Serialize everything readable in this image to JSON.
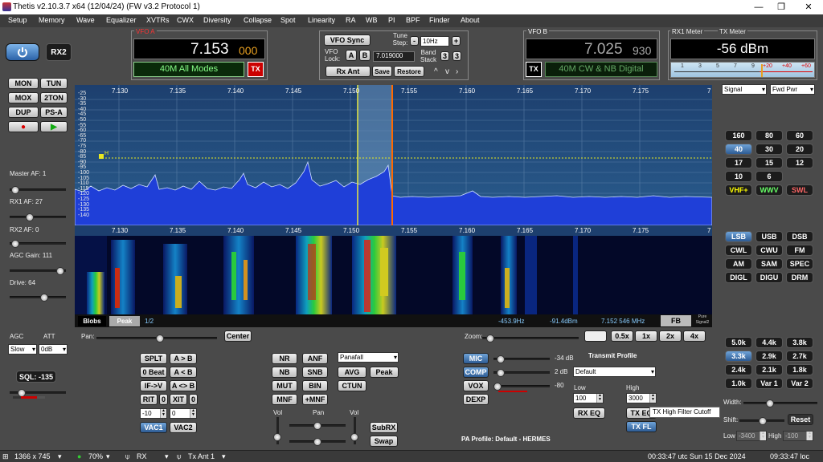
{
  "window": {
    "title": "Thetis v2.10.3.7 x64 (12/04/24) (FW v3.2 Protocol 1)",
    "min": "—",
    "max": "❐",
    "close": "✕"
  },
  "menu": [
    "Setup",
    "Memory",
    "Wave",
    "Equalizer",
    "XVTRs",
    "CWX",
    "Diversity",
    "Collapse",
    "Spot",
    "Linearity",
    "RA",
    "WB",
    "PI",
    "BPF",
    "Finder",
    "About"
  ],
  "power": {
    "rx2": "RX2"
  },
  "mode_buttons": {
    "mon": "MON",
    "tun": "TUN",
    "mox": "MOX",
    "tton": "2TON",
    "dup": "DUP",
    "psa": "PS-A"
  },
  "vfoa": {
    "label": "VFO A",
    "freq": "7.153",
    "freq_sub": "000",
    "mode": "40M All Modes",
    "tx": "TX"
  },
  "vfo_center": {
    "sync": "VFO Sync",
    "tune_step_label": "Tune Step:",
    "tune_step": "10Hz",
    "vfo_lock_label": "VFO Lock:",
    "a": "A",
    "b": "B",
    "lock_freq": "7.019000",
    "band_stack_label": "Band Stack",
    "bs1": "3",
    "bs2": "3",
    "rx_ant": "Rx Ant",
    "save": "Save",
    "restore": "Restore",
    "minus": "-",
    "plus": "+",
    "up": "^",
    "down": "v"
  },
  "vfob": {
    "label": "VFO B",
    "freq": "7.025",
    "freq_sub": "930",
    "mode": "40M CW & NB Digital",
    "tx": "TX"
  },
  "meters": {
    "rx1_label": "RX1 Meter",
    "tx_label": "TX Meter",
    "reading": "-56 dBm",
    "scale": [
      "1",
      "3",
      "5",
      "7",
      "9",
      "+20",
      "+40",
      "+60"
    ],
    "signal": "Signal",
    "fwd": "Fwd Pwr"
  },
  "panadapter": {
    "freqs": [
      "7.130",
      "7.135",
      "7.140",
      "7.145",
      "7.150",
      "7.155",
      "7.160",
      "7.165",
      "7.170",
      "7.175"
    ],
    "dbs": [
      "-25",
      "-30",
      "-35",
      "-40",
      "-45",
      "-50",
      "-55",
      "-60",
      "-65",
      "-70",
      "-75",
      "-80",
      "-85",
      "-90",
      "-95",
      "-100",
      "-105",
      "-110",
      "-115",
      "-120",
      "-125",
      "-130",
      "-135",
      "-140"
    ],
    "h_marker": "H",
    "edge": "7",
    "blobs": "Blobs",
    "peak": "Peak",
    "page": "1/2",
    "cursor_offset": "-453.9Hz",
    "cursor_db": "-91.4dBm",
    "cursor_freq": "7.152 546 MHz",
    "fb": "FB",
    "pure": "Pure Signal2"
  },
  "left": {
    "master_af": "Master AF:  1",
    "rx1_af": "RX1 AF:  27",
    "rx2_af": "RX2 AF:  0",
    "agc_gain": "AGC Gain:  111",
    "drive": "Drive:  64",
    "agc": "AGC",
    "att": "ATT",
    "agc_val": "Slow",
    "att_val": "0dB",
    "sql": "SQL: -135"
  },
  "bands": [
    "160",
    "80",
    "60",
    "40",
    "30",
    "20",
    "17",
    "15",
    "12",
    "10",
    "6",
    "VHF+",
    "WWV",
    "SWL"
  ],
  "modes": [
    "LSB",
    "USB",
    "DSB",
    "CWL",
    "CWU",
    "FM",
    "AM",
    "SAM",
    "SPEC",
    "DIGL",
    "DIGU",
    "DRM"
  ],
  "filters": [
    "5.0k",
    "4.4k",
    "3.8k",
    "3.3k",
    "2.9k",
    "2.7k",
    "2.4k",
    "2.1k",
    "1.8k",
    "1.0k",
    "Var 1",
    "Var 2"
  ],
  "filter_controls": {
    "width": "Width:",
    "shift": "Shift:",
    "reset": "Reset",
    "low": "Low",
    "low_val": "-3400",
    "high": "High",
    "high_val": "-100"
  },
  "pan_zoom": {
    "pan": "Pan:",
    "center": "Center",
    "zoom": "Zoom:",
    "z": [
      "0.5x",
      "1x",
      "2x",
      "4x"
    ]
  },
  "dsp": {
    "splt": "SPLT",
    "a2b": "A > B",
    "zbeat": "0 Beat",
    "b2a": "A < B",
    "ifv": "IF->V",
    "aswap": "A <> B",
    "rit": "RIT",
    "rit0": "0",
    "xit": "XIT",
    "xit0": "0",
    "rit_val": "-10",
    "xit_val": "0",
    "vac1": "VAC1",
    "vac2": "VAC2",
    "nr": "NR",
    "anf": "ANF",
    "nb": "NB",
    "snb": "SNB",
    "mut": "MUT",
    "bin": "BIN",
    "mnf": "MNF",
    "pmnf": "+MNF",
    "display": "Panafall",
    "avg": "AVG",
    "peak": "Peak",
    "ctun": "CTUN",
    "vol": "Vol",
    "pan": "Pan",
    "vol2": "Vol",
    "subrx": "SubRX",
    "swap": "Swap"
  },
  "tx": {
    "mic": "MIC",
    "mic_val": "-34 dB",
    "comp": "COMP",
    "comp_val": "2 dB",
    "vox": "VOX",
    "vox_val": "-80",
    "dexp": "DEXP",
    "profile_label": "Transmit Profile",
    "profile": "Default",
    "low": "Low",
    "low_val": "100",
    "high": "High",
    "high_val": "3000",
    "rx_eq": "RX EQ",
    "tx_eq": "TX EQ",
    "tx_fl": "TX FL",
    "tooltip": "TX High Filter Cutoff",
    "pa_profile": "PA Profile: Default - HERMES"
  },
  "status": {
    "res": "1366 x 745",
    "cpu": "70%",
    "rx": "RX",
    "txant": "Tx Ant 1",
    "utc": "00:33:47 utc  Sun 15 Dec 2024",
    "loc": "09:33:47 loc"
  }
}
